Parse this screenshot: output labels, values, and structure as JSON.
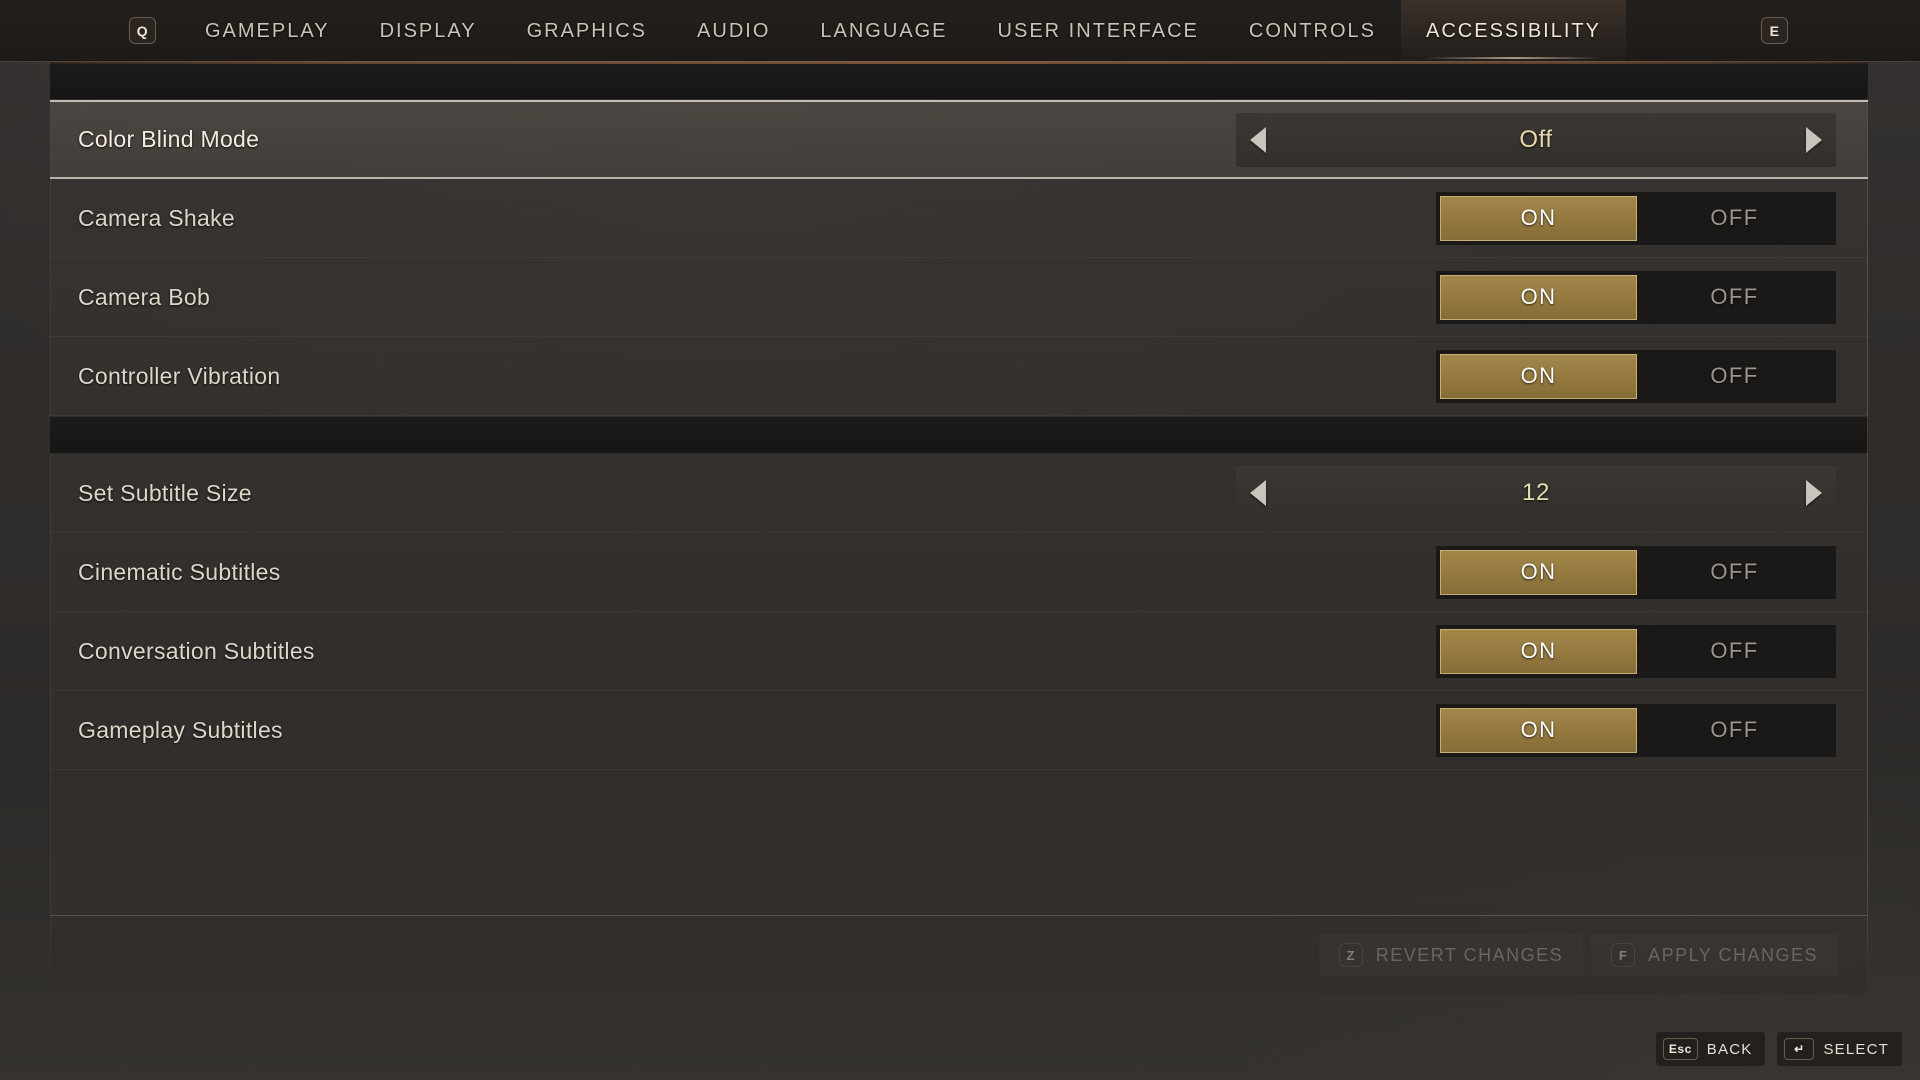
{
  "topbar": {
    "prev_key": "Q",
    "next_key": "E",
    "tabs": [
      {
        "label": "GAMEPLAY",
        "active": false
      },
      {
        "label": "DISPLAY",
        "active": false
      },
      {
        "label": "GRAPHICS",
        "active": false
      },
      {
        "label": "AUDIO",
        "active": false
      },
      {
        "label": "LANGUAGE",
        "active": false
      },
      {
        "label": "USER INTERFACE",
        "active": false
      },
      {
        "label": "CONTROLS",
        "active": false
      },
      {
        "label": "ACCESSIBILITY",
        "active": true
      }
    ]
  },
  "settings": {
    "sections": [
      {
        "title": "",
        "rows": [
          {
            "label": "Color Blind Mode",
            "control": "stepper",
            "value": "Off",
            "selected": true
          },
          {
            "label": "Camera Shake",
            "control": "toggle",
            "value": "ON",
            "selected": false
          },
          {
            "label": "Camera Bob",
            "control": "toggle",
            "value": "ON",
            "selected": false
          },
          {
            "label": "Controller Vibration",
            "control": "toggle",
            "value": "ON",
            "selected": false
          }
        ]
      },
      {
        "title": "",
        "rows": [
          {
            "label": "Set Subtitle Size",
            "control": "stepper",
            "value": "12",
            "selected": false
          },
          {
            "label": "Cinematic Subtitles",
            "control": "toggle",
            "value": "ON",
            "selected": false
          },
          {
            "label": "Conversation Subtitles",
            "control": "toggle",
            "value": "ON",
            "selected": false
          },
          {
            "label": "Gameplay Subtitles",
            "control": "toggle",
            "value": "ON",
            "selected": false
          }
        ]
      }
    ],
    "toggle_options": {
      "on": "ON",
      "off": "OFF"
    }
  },
  "actions": [
    {
      "key": "Z",
      "label": "REVERT CHANGES"
    },
    {
      "key": "F",
      "label": "APPLY CHANGES"
    }
  ],
  "hints": [
    {
      "key": "Esc",
      "label": "BACK"
    },
    {
      "key": "↵",
      "label": "SELECT"
    }
  ],
  "colors": {
    "accent_gold": "#93793f",
    "accent_gold_border": "#c9ae74",
    "value_text": "#e8dcae",
    "label_text": "#ded6c9",
    "panel_bg": "#343030"
  }
}
